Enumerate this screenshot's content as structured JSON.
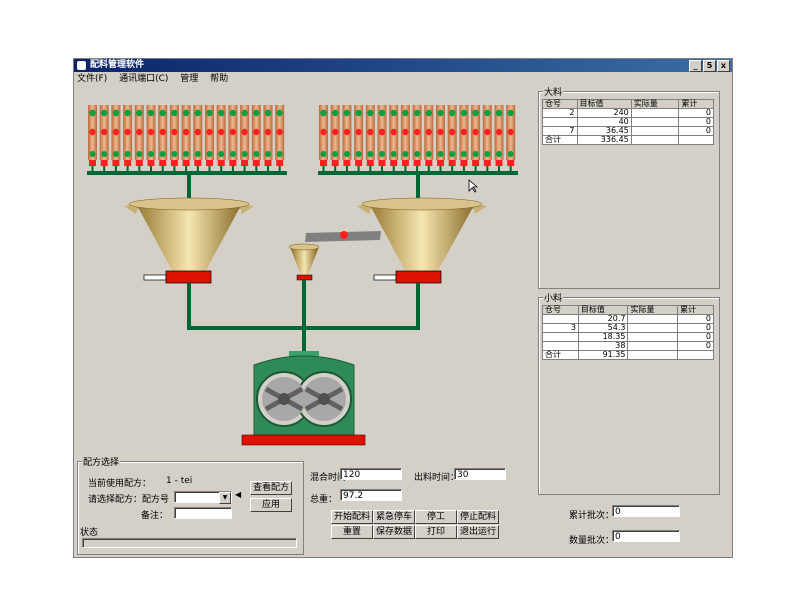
{
  "window": {
    "title": "配料管理软件",
    "controls": [
      "_",
      "5",
      "x"
    ]
  },
  "menu": [
    "文件(F)",
    "通讯端口(C)",
    "管理",
    "帮助"
  ],
  "panel_top": {
    "legend": "大料",
    "headers": [
      "仓号",
      "目标值",
      "实际量",
      "累计"
    ],
    "rows": [
      [
        "2",
        "240",
        "",
        "0"
      ],
      [
        "",
        "40",
        "",
        "0"
      ],
      [
        "7",
        "36.45",
        "",
        "0"
      ]
    ],
    "total_label": "合计",
    "total_value": "336.45"
  },
  "panel_bottom": {
    "legend": "小料",
    "headers": [
      "仓号",
      "目标值",
      "实际量",
      "累计"
    ],
    "rows": [
      [
        "",
        "20.7",
        "",
        "0"
      ],
      [
        "3",
        "54.3",
        "",
        "0"
      ],
      [
        "",
        "18.35",
        "",
        "0"
      ],
      [
        "",
        "38",
        "",
        "0"
      ]
    ],
    "total_label": "合计",
    "total_value": "91.35"
  },
  "recipe": {
    "legend": "配方选择",
    "current_label": "当前使用配方：",
    "current_value": "1 - tei",
    "select_label": "请选择配方：",
    "select_sub": "配方号",
    "select_value": "",
    "remark_label": "备注：",
    "remark_value": "",
    "query_button": "查看配方",
    "apply_button": "应用",
    "status_label": "状态"
  },
  "params": {
    "mix_time_label": "混合时间：",
    "mix_time_value": "120",
    "discharge_time_label": "出料时间：",
    "discharge_time_value": "30",
    "total_label": "总重：",
    "total_value": "97.2"
  },
  "buttons": [
    "开始配料",
    "紧急停车",
    "停工",
    "停止配料",
    "重置",
    "保存数据",
    "打印",
    "退出运行"
  ],
  "stats": {
    "batch_label": "累计批次：",
    "batch_value": "0",
    "count_label": "数量批次：",
    "count_value": "0"
  },
  "colors": {
    "pipe": "#006633",
    "silo": "#cd8b58",
    "valve_green": "#00a040",
    "valve_red": "#ff2020",
    "mixer_body": "#2e8b57",
    "gate_red": "#dd1100"
  }
}
